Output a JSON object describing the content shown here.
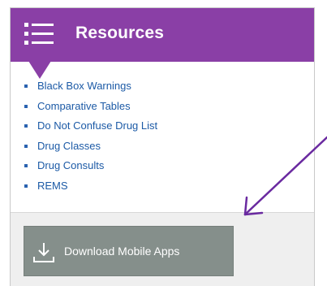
{
  "resources": {
    "title": "Resources",
    "menu_icon": "hamburger-list-icon",
    "links": [
      {
        "label": "Black Box Warnings"
      },
      {
        "label": "Comparative Tables"
      },
      {
        "label": "Do Not Confuse Drug List"
      },
      {
        "label": "Drug Classes"
      },
      {
        "label": "Drug Consults"
      },
      {
        "label": "REMS"
      }
    ]
  },
  "footer": {
    "download_label": "Download Mobile Apps",
    "download_icon": "download-icon"
  },
  "colors": {
    "header_bg": "#8a3fa6",
    "link_text": "#1c5aa6",
    "button_bg": "#858f8b",
    "annotation_arrow": "#6a2aa0"
  }
}
